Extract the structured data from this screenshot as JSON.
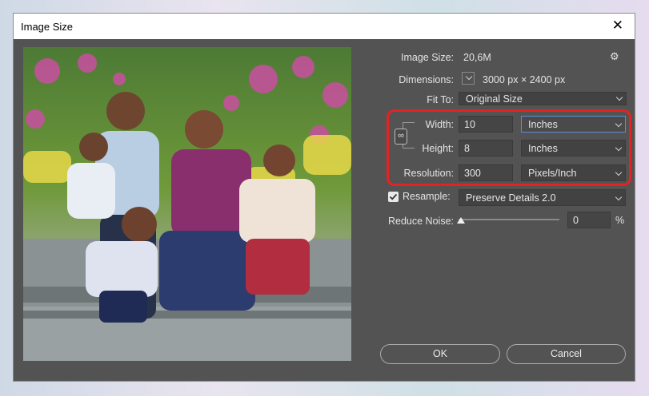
{
  "window": {
    "title": "Image Size"
  },
  "info": {
    "image_size_label": "Image Size:",
    "image_size_value": "20,6M",
    "dimensions_label": "Dimensions:",
    "dimensions_value": "3000 px  ×  2400 px",
    "fit_to_label": "Fit To:",
    "fit_to_value": "Original Size"
  },
  "fields": {
    "width_label": "Width:",
    "width_value": "10",
    "width_unit": "Inches",
    "height_label": "Height:",
    "height_value": "8",
    "height_unit": "Inches",
    "resolution_label": "Resolution:",
    "resolution_value": "300",
    "resolution_unit": "Pixels/Inch"
  },
  "resample": {
    "label": "Resample:",
    "checked": true,
    "method": "Preserve Details 2.0"
  },
  "noise": {
    "label": "Reduce Noise:",
    "value": "0",
    "unit": "%"
  },
  "buttons": {
    "ok": "OK",
    "cancel": "Cancel"
  },
  "colors": {
    "dialog_bg": "#535353",
    "highlight": "#e32322"
  }
}
